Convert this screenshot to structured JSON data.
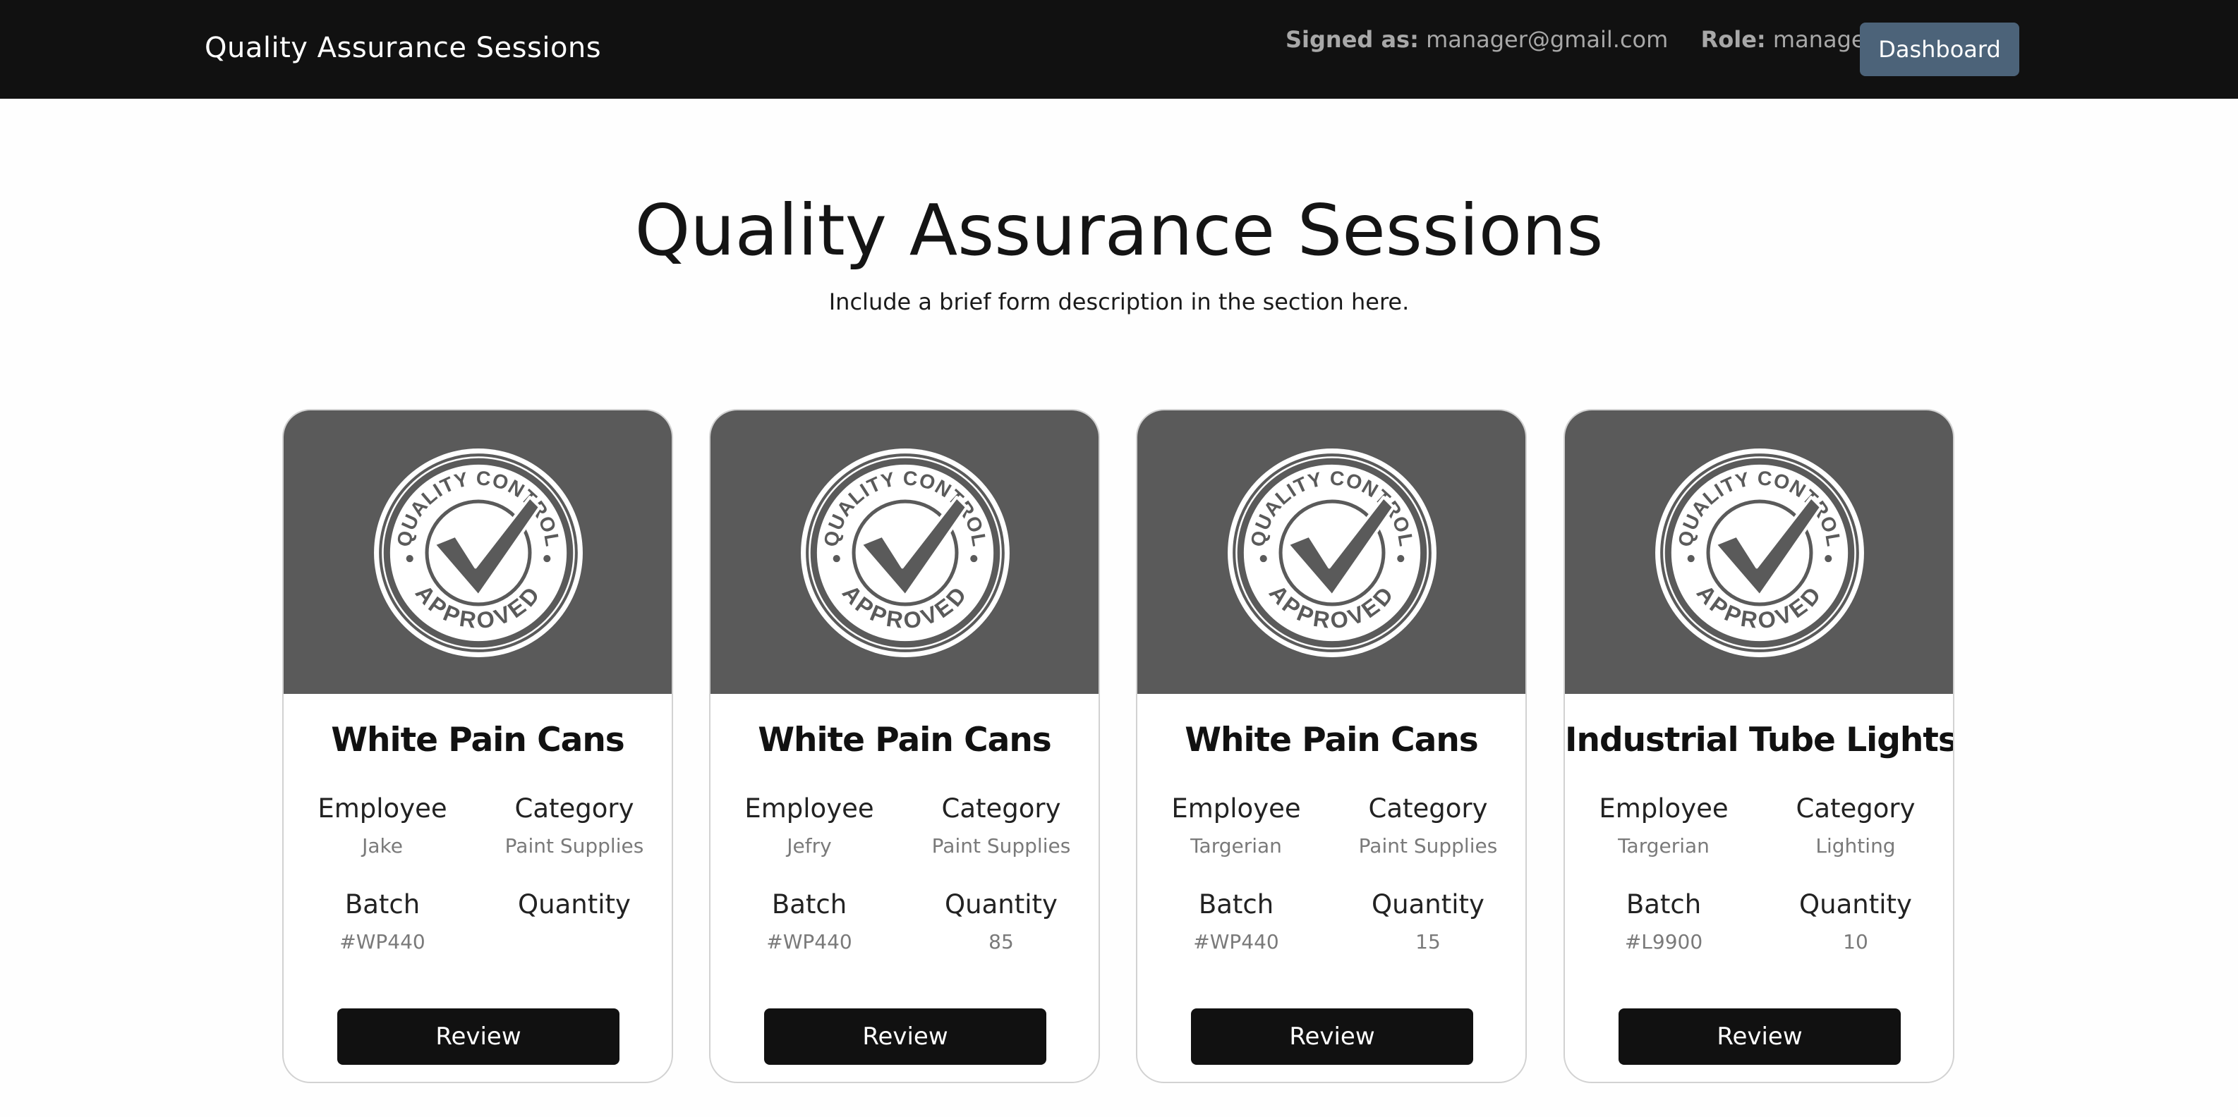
{
  "navbar": {
    "brand": "Quality Assurance Sessions",
    "signed_label": "Signed as:",
    "signed_value": "manager@gmail.com",
    "role_label": "Role:",
    "role_value": "manager",
    "dashboard_label": "Dashboard"
  },
  "header": {
    "title": "Quality Assurance Sessions",
    "description": "Include a brief form description in the section here."
  },
  "badge": {
    "top_text": "QUALITY CONTROL",
    "bottom_text": "APPROVED",
    "icon": "quality-control-approved-badge"
  },
  "labels": {
    "employee": "Employee",
    "category": "Category",
    "batch": "Batch",
    "quantity": "Quantity",
    "review": "Review"
  },
  "cards": [
    {
      "title": "White Pain Cans",
      "employee": "Jake",
      "category": "Paint Supplies",
      "batch": "#WP440",
      "quantity": ""
    },
    {
      "title": "White Pain Cans",
      "employee": "Jefry",
      "category": "Paint Supplies",
      "batch": "#WP440",
      "quantity": "85"
    },
    {
      "title": "White Pain Cans",
      "employee": "Targerian",
      "category": "Paint Supplies",
      "batch": "#WP440",
      "quantity": "15"
    },
    {
      "title": "Industrial Tube Lights",
      "employee": "Targerian",
      "category": "Lighting",
      "batch": "#L9900",
      "quantity": "10"
    }
  ],
  "colors": {
    "navbar_bg": "#111111",
    "dashboard_button": "#4c6379",
    "card_media_bg": "#5a5a5a",
    "review_button": "#111111"
  }
}
